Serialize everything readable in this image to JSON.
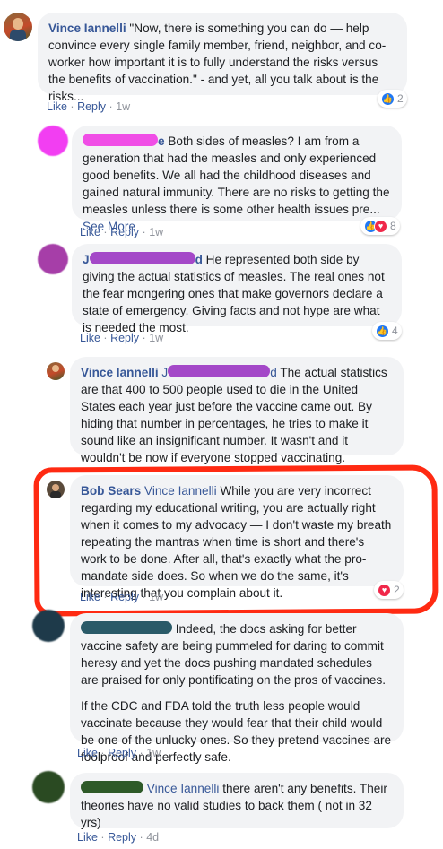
{
  "comments": [
    {
      "name": "Vince Iannelli",
      "text": "\"Now, there is something you can do — help convince every single family member, friend, neighbor, and co-worker how important it is to fully understand the risks versus the benefits of vaccination.\" - and yet, all you talk about is the risks...",
      "actions": {
        "like": "Like",
        "reply": "Reply",
        "time": "1w"
      },
      "reactions": {
        "count": "2",
        "icons": [
          "like-icon"
        ]
      }
    },
    {
      "name_partial": "e",
      "text": "Both sides of measles? I am from a generation that had the measles and only experienced good benefits. We all had the childhood diseases and gained natural immunity. There are no risks to getting the measles unless there is some other health issues pre...",
      "see_more": "See More",
      "actions": {
        "like": "Like",
        "reply": "Reply",
        "time": "1w"
      },
      "reactions": {
        "count": "8",
        "icons": [
          "like-icon",
          "love-icon"
        ]
      }
    },
    {
      "name_partial_start": "J",
      "name_partial_end": "d",
      "text": "He represented both side by giving the actual statistics of measles. The real ones not the fear mongering ones that make governors declare a state of emergency. Giving facts and not hype are what is needed the most.",
      "actions": {
        "like": "Like",
        "reply": "Reply",
        "time": "1w"
      },
      "reactions": {
        "count": "4",
        "icons": [
          "like-icon"
        ]
      }
    },
    {
      "name": "Vince Iannelli",
      "mention_start": "J",
      "mention_end": "d",
      "text": "The actual statistics are that 400 to 500 people used to die in the United States each year just before the vaccine came out. By hiding that number in percentages, he tries to make it sound like an insignificant number. It wasn't and it wouldn't be now if everyone stopped vaccinating."
    },
    {
      "name": "Bob Sears",
      "mention": "Vince Iannelli",
      "text": "While you are very incorrect regarding my educational writing, you are actually right when it comes to my advocacy — I don't waste my breath repeating the mantras when time is short and there's work to be done. After all, that's exactly what the pro-mandate side does. So when we do the same, it's interesting that you complain about it.",
      "actions": {
        "like": "Like",
        "reply": "Reply",
        "time": "1w"
      },
      "reactions": {
        "count": "2",
        "icons": [
          "love-icon"
        ]
      }
    },
    {
      "text": "Indeed, the docs asking for better vaccine safety are being pummeled for daring to commit heresy and yet the docs pushing mandated schedules are praised for only pontificating on the pros of vaccines.",
      "text2": "If the CDC and FDA told the truth less people would vaccinate because they would fear that their child would be one of the unlucky ones. So they pretend vaccines are foolproof and perfectly safe.",
      "actions": {
        "like": "Like",
        "reply": "Reply",
        "time": "1w"
      }
    },
    {
      "mention": "Vince Iannelli",
      "text": "there aren't any benefits. Their theories have no valid studies to back them ( not in 32 yrs)",
      "actions": {
        "like": "Like",
        "reply": "Reply",
        "time": "4d"
      }
    }
  ],
  "colors": {
    "link": "#385898",
    "bubble": "#f2f3f5",
    "highlight": "#ff2a12",
    "like": "#2078f4",
    "love": "#f0284a"
  }
}
